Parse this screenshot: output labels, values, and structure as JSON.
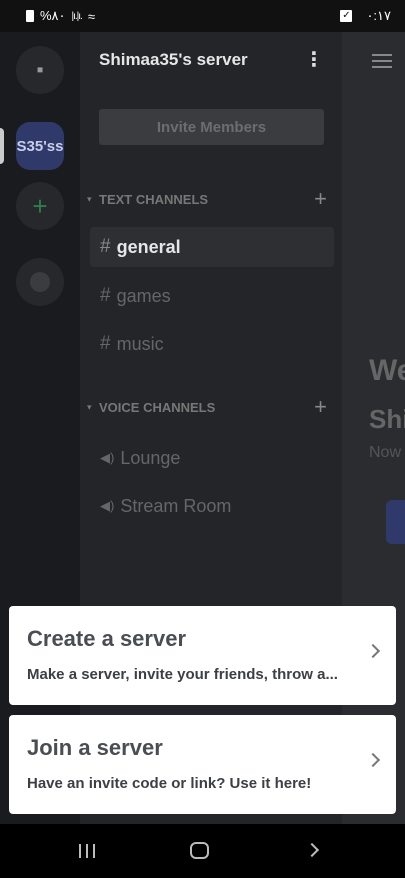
{
  "status_bar": {
    "left_text": "%۸۰",
    "time": "۰:۱۷"
  },
  "server": {
    "name": "Shimaa35's server",
    "icon_text": "S35'ss",
    "invite_label": "Invite Members"
  },
  "categories": {
    "text": "TEXT CHANNELS",
    "voice": "VOICE CHANNELS"
  },
  "text_channels": [
    "general",
    "games",
    "music"
  ],
  "voice_channels": [
    "Lounge",
    "Stream Room"
  ],
  "main": {
    "welcome_line1": "We",
    "welcome_line2": "Shi",
    "welcome_line3": "Now"
  },
  "sheet": {
    "create_title": "Create a server",
    "create_desc": "Make a server, invite your friends, throw a...",
    "join_title": "Join a server",
    "join_desc": "Have an invite code or link? Use it here!"
  },
  "colors": {
    "sheet_bg": "#ffffff",
    "app_bg": "#202225",
    "server_icon": "#2f3a6a",
    "add_green": "#2f7d4a"
  }
}
